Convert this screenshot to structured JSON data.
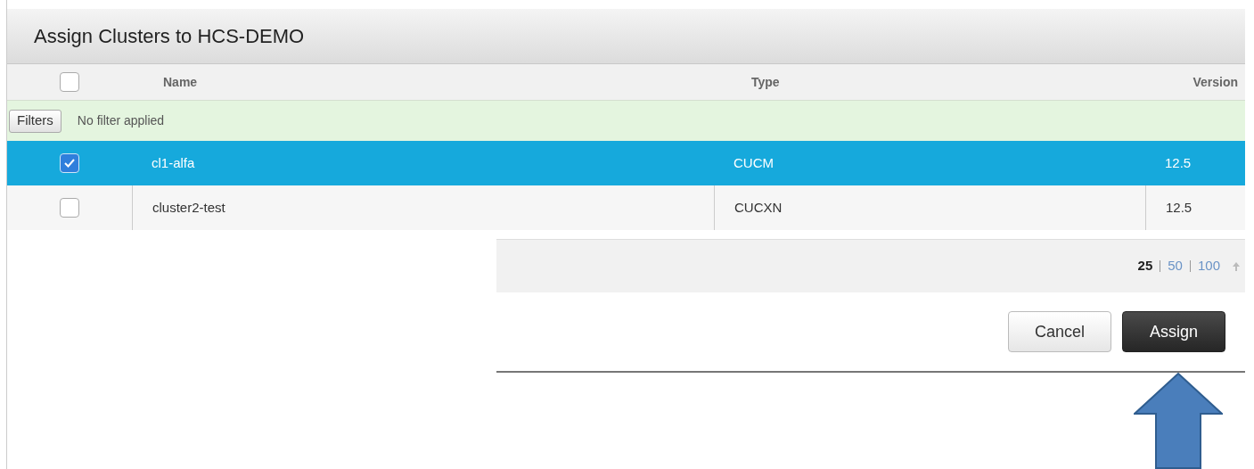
{
  "dialog": {
    "title": "Assign Clusters to HCS-DEMO"
  },
  "table": {
    "select_all": {
      "checked": false
    },
    "columns": [
      "Name",
      "Type",
      "Version"
    ],
    "filter": {
      "button": "Filters",
      "status": "No filter applied"
    },
    "rows": [
      {
        "selected": true,
        "cells": [
          "cl1-alfa",
          "CUCM",
          "12.5"
        ]
      },
      {
        "selected": false,
        "cells": [
          "cluster2-test",
          "CUCXN",
          "12.5"
        ]
      }
    ]
  },
  "page_sizes": [
    {
      "label": "25",
      "selected": true
    },
    {
      "label": "50",
      "selected": false
    },
    {
      "label": "100",
      "selected": false
    }
  ],
  "buttons": [
    {
      "label": "Cancel",
      "kind": "secondary"
    },
    {
      "label": "Assign",
      "kind": "primary"
    }
  ]
}
